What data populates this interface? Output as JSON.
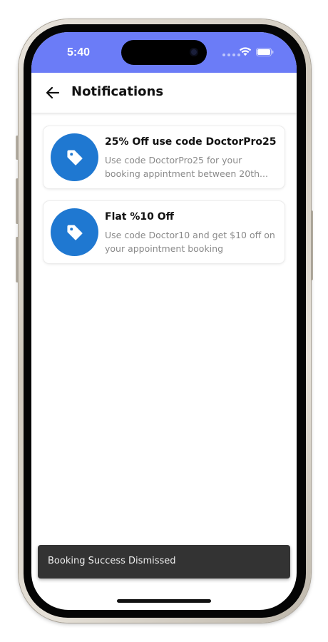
{
  "status_bar": {
    "time": "5:40",
    "background_color": "#6b7cf7",
    "icons": [
      "signal-dots-icon",
      "wifi-icon",
      "battery-icon"
    ]
  },
  "app_bar": {
    "back_icon": "arrow-left-icon",
    "title": "Notifications"
  },
  "notifications": [
    {
      "icon": "tag-icon",
      "title": "25% Off use code DoctorPro25",
      "body": "Use code DoctorPro25 for your booking appintment between 20th..."
    },
    {
      "icon": "tag-icon",
      "title": "Flat %10 Off",
      "body": "Use code Doctor10 and get $10 off on your appointment booking"
    }
  ],
  "snackbar": {
    "message": "Booking Success Dismissed"
  },
  "colors": {
    "accent": "#1f78d1",
    "snackbar": "#333333"
  }
}
